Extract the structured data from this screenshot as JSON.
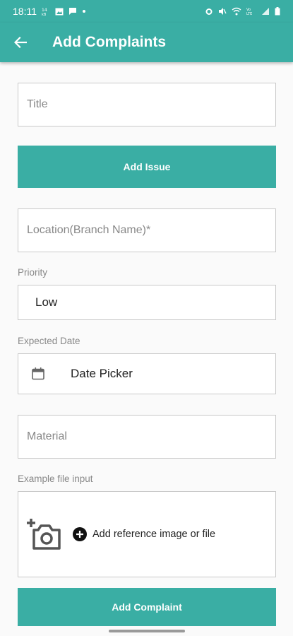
{
  "status_bar": {
    "time": "18:11",
    "left_icons": [
      "data-icon",
      "image-icon",
      "message-icon",
      "dot-icon"
    ],
    "right_icons": [
      "alarm-icon",
      "mute-icon",
      "wifi-icon",
      "volte-icon",
      "signal-icon",
      "battery-icon"
    ]
  },
  "app_bar": {
    "title": "Add Complaints",
    "back_icon": "arrow-left-icon"
  },
  "form": {
    "title_placeholder": "Title",
    "add_issue_label": "Add Issue",
    "location_placeholder": "Location(Branch Name)*",
    "priority_label": "Priority",
    "priority_value": "Low",
    "expected_date_label": "Expected Date",
    "date_picker_text": "Date Picker",
    "material_placeholder": "Material",
    "file_input_label": "Example file input",
    "file_input_text": "Add reference image or file",
    "submit_label": "Add Complaint"
  },
  "colors": {
    "accent": "#3aaea4",
    "background": "#fafafa",
    "border": "#c9c9c9"
  }
}
